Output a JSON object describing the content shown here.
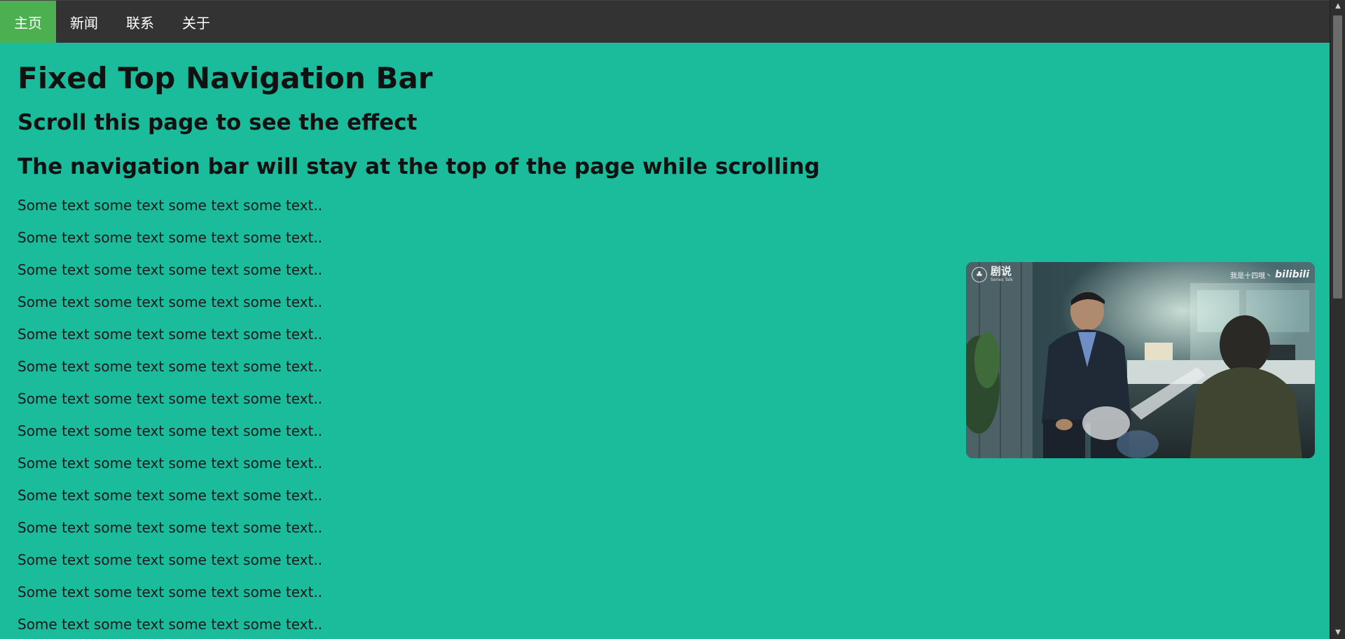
{
  "navbar": {
    "items": [
      {
        "label": "主页",
        "active": true
      },
      {
        "label": "新闻",
        "active": false
      },
      {
        "label": "联系",
        "active": false
      },
      {
        "label": "关于",
        "active": false
      }
    ]
  },
  "main": {
    "title": "Fixed Top Navigation Bar",
    "subtitle_1": "Scroll this page to see the effect",
    "subtitle_2": "The navigation bar will stay at the top of the page while scrolling",
    "paragraph_text": "Some text some text some text some text..",
    "paragraph_count": 14
  },
  "video": {
    "logo_text": "剧说",
    "logo_subtext": "Series Talk",
    "uploader_watermark": "我是十四哦丶",
    "platform_watermark": "bilibili"
  },
  "colors": {
    "page_background": "#1abc9c",
    "navbar_background": "#333333",
    "nav_active": "#4caf50",
    "scrollbar_track": "#2e2e2e",
    "scrollbar_thumb": "#6b6b6b"
  }
}
